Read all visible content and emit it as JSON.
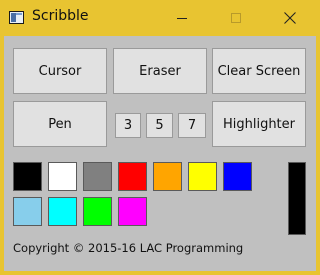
{
  "window": {
    "title": "Scribble",
    "accent_color": "#e8c431",
    "controls": {
      "minimize": "minimize",
      "maximize": "maximize",
      "close": "close"
    }
  },
  "toolbar": {
    "cursor_label": "Cursor",
    "eraser_label": "Eraser",
    "clear_label": "Clear Screen",
    "pen_label": "Pen",
    "size_options": [
      "3",
      "5",
      "7"
    ],
    "highlighter_label": "Highlighter"
  },
  "palette": {
    "colors": [
      "#000000",
      "#ffffff",
      "#808080",
      "#ff0000",
      "#ffa500",
      "#ffff00",
      "#0000ff",
      "#87ceeb",
      "#00ffff",
      "#00ff00",
      "#ff00ff"
    ],
    "current_color": "#000000"
  },
  "footer": {
    "copyright": "Copyright © 2015-16 LAC Programming"
  }
}
